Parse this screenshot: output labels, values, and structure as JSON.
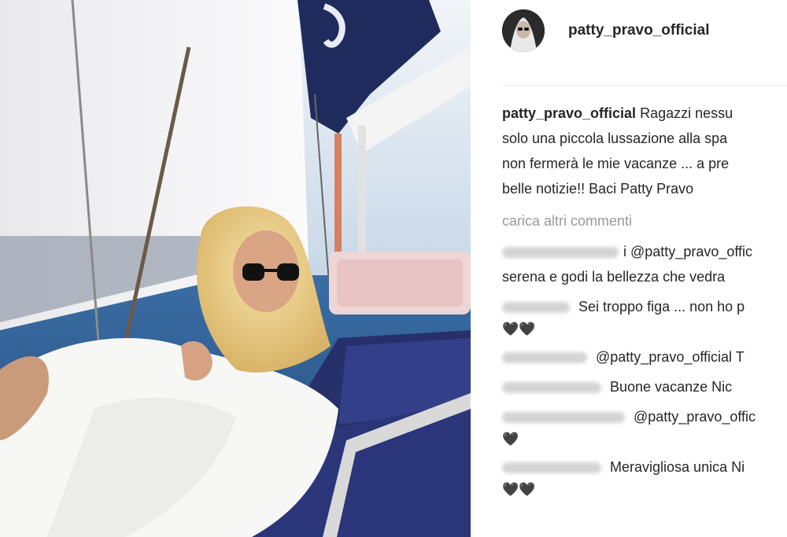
{
  "post": {
    "username": "patty_pravo_official",
    "caption_user": "patty_pravo_official",
    "caption_lines": [
      " Ragazzi nessu",
      "solo una piccola lussazione alla spa",
      "non fermerà le mie vacanze ... a pre",
      "belle notizie!! Baci Patty Pravo"
    ],
    "load_more": "carica altri commenti"
  },
  "comments": [
    {
      "author_suffix": "i",
      "lines": [
        "@patty_pravo_offic",
        "serena e godi la bellezza che vedra"
      ]
    },
    {
      "author_suffix": "",
      "lines": [
        "Sei troppo figa ... non ho p",
        "🖤🖤"
      ]
    },
    {
      "author_suffix": "",
      "lines": [
        "@patty_pravo_official T"
      ]
    },
    {
      "author_suffix": "",
      "lines": [
        "Buone vacanze Nic"
      ]
    },
    {
      "author_suffix": "",
      "lines": [
        "@patty_pravo_offic",
        "🖤"
      ]
    },
    {
      "author_suffix": "",
      "lines": [
        "Meravigliosa unica Ni",
        "🖤🖤"
      ]
    }
  ],
  "colors": {
    "text": "#262626",
    "muted": "#999999",
    "divider": "#efefef",
    "sail_navy": "#1f2b5c"
  }
}
